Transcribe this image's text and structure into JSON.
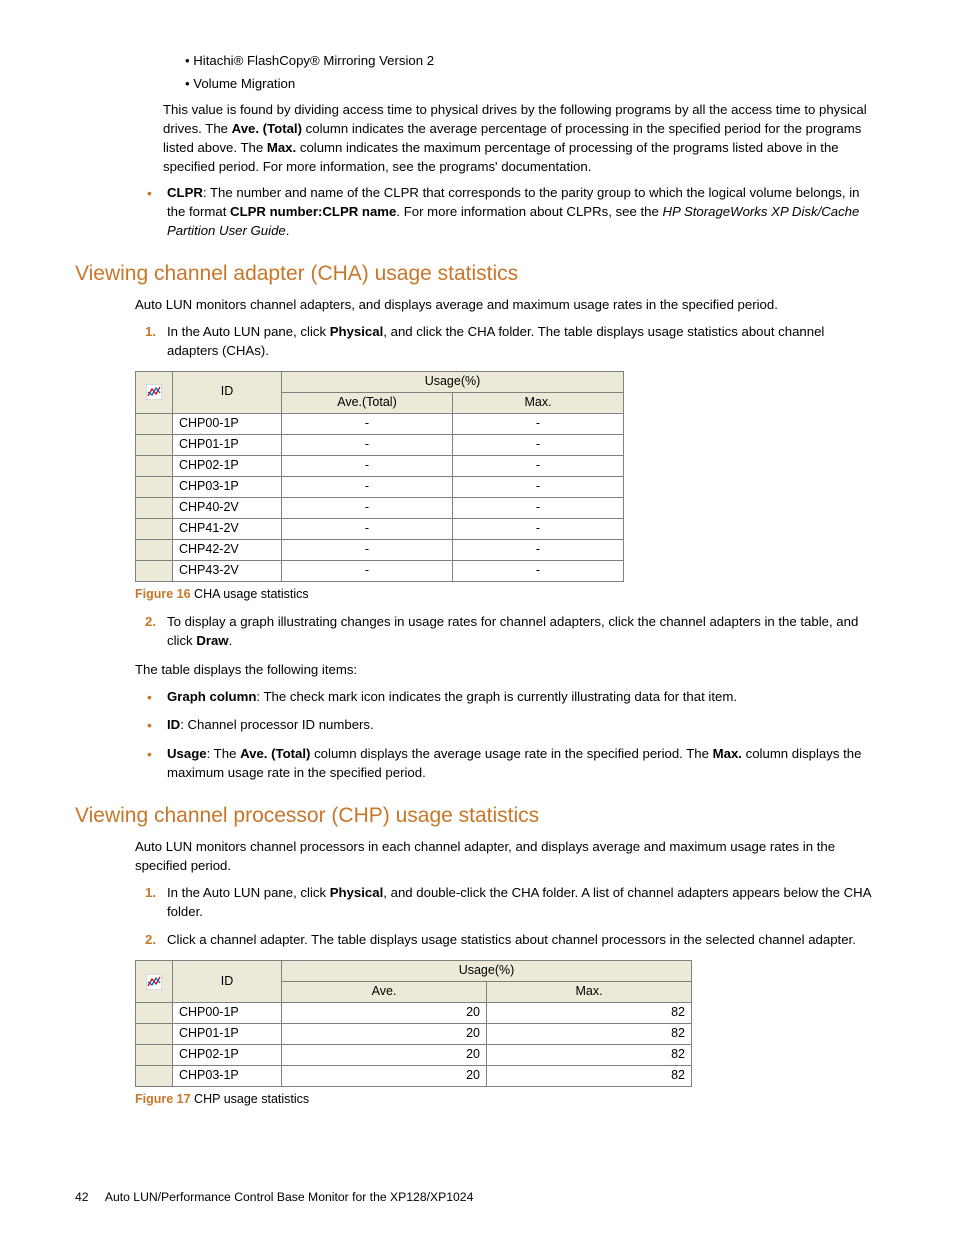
{
  "intro": {
    "bullets": [
      "Hitachi® FlashCopy® Mirroring Version 2",
      "Volume Migration"
    ],
    "para1_a": "This value is found by dividing access time to physical drives by the following programs by all the access time to physical drives. The ",
    "ave_total": "Ave. (Total)",
    "para1_b": " column indicates the average percentage of processing in the specified period for the programs listed above. The ",
    "max": "Max.",
    "para1_c": " column indicates the maximum percentage of processing of the programs listed above in the specified period. For more information, see the programs' documentation.",
    "clpr_label": "CLPR",
    "clpr_a": ": The number and name of the CLPR that corresponds to the parity group to which the logical volume belongs, in the format ",
    "clpr_fmt": "CLPR number:CLPR name",
    "clpr_b": ". For more information about CLPRs, see the ",
    "clpr_doc": "HP StorageWorks XP Disk/Cache Partition User Guide",
    "clpr_c": "."
  },
  "sec1": {
    "heading": "Viewing channel adapter (CHA) usage statistics",
    "lead": "Auto LUN monitors channel adapters, and displays average and maximum usage rates in the specified period.",
    "step1_a": "In the Auto LUN pane, click ",
    "step1_phys": "Physical",
    "step1_b": ", and click the CHA folder. The table displays usage statistics about channel adapters (CHAs).",
    "step2_a": "To display a graph illustrating changes in usage rates for channel adapters, click the channel adapters in the table, and click ",
    "step2_draw": "Draw",
    "step2_b": ".",
    "after": "The table displays the following items:",
    "bul_graph_l": "Graph column",
    "bul_graph": ": The check mark icon indicates the graph is currently illustrating data for that item.",
    "bul_id_l": "ID",
    "bul_id": ": Channel processor ID numbers.",
    "bul_usage_l": "Usage",
    "bul_usage_a": ": The ",
    "bul_usage_ave": "Ave. (Total)",
    "bul_usage_b": " column displays the average usage rate in the specified period. The ",
    "bul_usage_max": "Max.",
    "bul_usage_c": " column displays the maximum usage rate in the specified period.",
    "table": {
      "h_id": "ID",
      "h_usage": "Usage(%)",
      "h_ave": "Ave.(Total)",
      "h_max": "Max.",
      "rows": [
        {
          "id": "CHP00-1P",
          "ave": "-",
          "max": "-"
        },
        {
          "id": "CHP01-1P",
          "ave": "-",
          "max": "-"
        },
        {
          "id": "CHP02-1P",
          "ave": "-",
          "max": "-"
        },
        {
          "id": "CHP03-1P",
          "ave": "-",
          "max": "-"
        },
        {
          "id": "CHP40-2V",
          "ave": "-",
          "max": "-"
        },
        {
          "id": "CHP41-2V",
          "ave": "-",
          "max": "-"
        },
        {
          "id": "CHP42-2V",
          "ave": "-",
          "max": "-"
        },
        {
          "id": "CHP43-2V",
          "ave": "-",
          "max": "-"
        }
      ]
    },
    "fig_label": "Figure 16",
    "fig_text": " CHA usage statistics"
  },
  "sec2": {
    "heading": "Viewing channel processor (CHP) usage statistics",
    "lead": "Auto LUN monitors channel processors in each channel adapter, and displays average and maximum usage rates in the specified period.",
    "step1_a": "In the Auto LUN pane, click ",
    "step1_phys": "Physical",
    "step1_b": ", and double-click the CHA folder. A list of channel adapters appears below the CHA folder.",
    "step2": "Click a channel adapter. The table displays usage statistics about channel processors in the selected channel adapter.",
    "table": {
      "h_id": "ID",
      "h_usage": "Usage(%)",
      "h_ave": "Ave.",
      "h_max": "Max.",
      "rows": [
        {
          "id": "CHP00-1P",
          "ave": "20",
          "max": "82"
        },
        {
          "id": "CHP01-1P",
          "ave": "20",
          "max": "82"
        },
        {
          "id": "CHP02-1P",
          "ave": "20",
          "max": "82"
        },
        {
          "id": "CHP03-1P",
          "ave": "20",
          "max": "82"
        }
      ]
    },
    "fig_label": "Figure 17",
    "fig_text": " CHP usage statistics"
  },
  "footer": {
    "page": "42",
    "title": "Auto LUN/Performance Control Base Monitor for the XP128/XP1024"
  }
}
